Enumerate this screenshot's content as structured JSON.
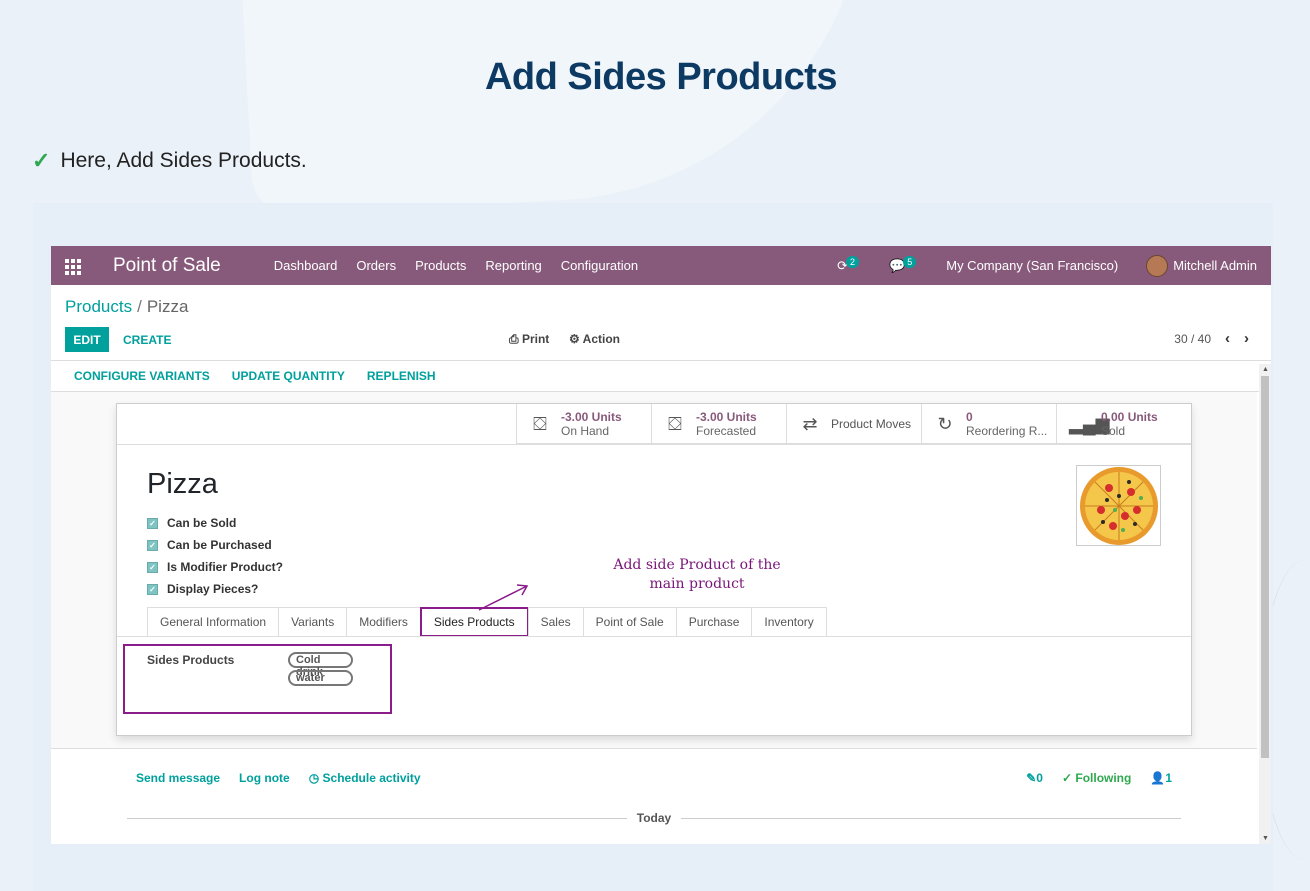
{
  "slide": {
    "title": "Add Sides Products",
    "bullet": "Here, Add Sides Products."
  },
  "navbar": {
    "app_name": "Point of Sale",
    "menu": [
      "Dashboard",
      "Orders",
      "Products",
      "Reporting",
      "Configuration"
    ],
    "activity_count": "2",
    "message_count": "5",
    "company": "My Company (San Francisco)",
    "user": "Mitchell Admin"
  },
  "breadcrumb": {
    "parent": "Products",
    "separator": "/",
    "current": "Pizza"
  },
  "toolbar": {
    "edit": "EDIT",
    "create": "CREATE",
    "print": "Print",
    "action": "Action",
    "pager": "30 / 40"
  },
  "statusbar": {
    "buttons": [
      "CONFIGURE VARIANTS",
      "UPDATE QUANTITY",
      "REPLENISH"
    ]
  },
  "smart_buttons": [
    {
      "value": "-3.00 Units",
      "label": "On Hand",
      "icon": "cubes-icon"
    },
    {
      "value": "-3.00 Units",
      "label": "Forecasted",
      "icon": "cubes-icon"
    },
    {
      "value": "Product Moves",
      "label": "",
      "icon": "exchange-icon"
    },
    {
      "value": "0",
      "label": "Reordering R...",
      "icon": "refresh-icon"
    },
    {
      "value": "0.00 Units",
      "label": "Sold",
      "icon": "signal-icon"
    }
  ],
  "product": {
    "name": "Pizza",
    "checkboxes": [
      "Can be Sold",
      "Can be Purchased",
      "Is Modifier Product?",
      "Display Pieces?"
    ]
  },
  "tabs": [
    "General Information",
    "Variants",
    "Modifiers",
    "Sides Products",
    "Sales",
    "Point of Sale",
    "Purchase",
    "Inventory"
  ],
  "active_tab": "Sides Products",
  "annotation": {
    "line1": "Add side Product of the",
    "line2": "main product"
  },
  "sides": {
    "label": "Sides Products",
    "tags": [
      "Cold drink",
      "water"
    ]
  },
  "chatter": {
    "send_message": "Send message",
    "log_note": "Log note",
    "schedule": "Schedule activity",
    "attachments": "0",
    "following": "Following",
    "followers": "1",
    "today": "Today"
  },
  "colors": {
    "brand": "#875a7b",
    "accent": "#00a09d",
    "highlight": "#8b1d8a",
    "title": "#0d3a63"
  }
}
